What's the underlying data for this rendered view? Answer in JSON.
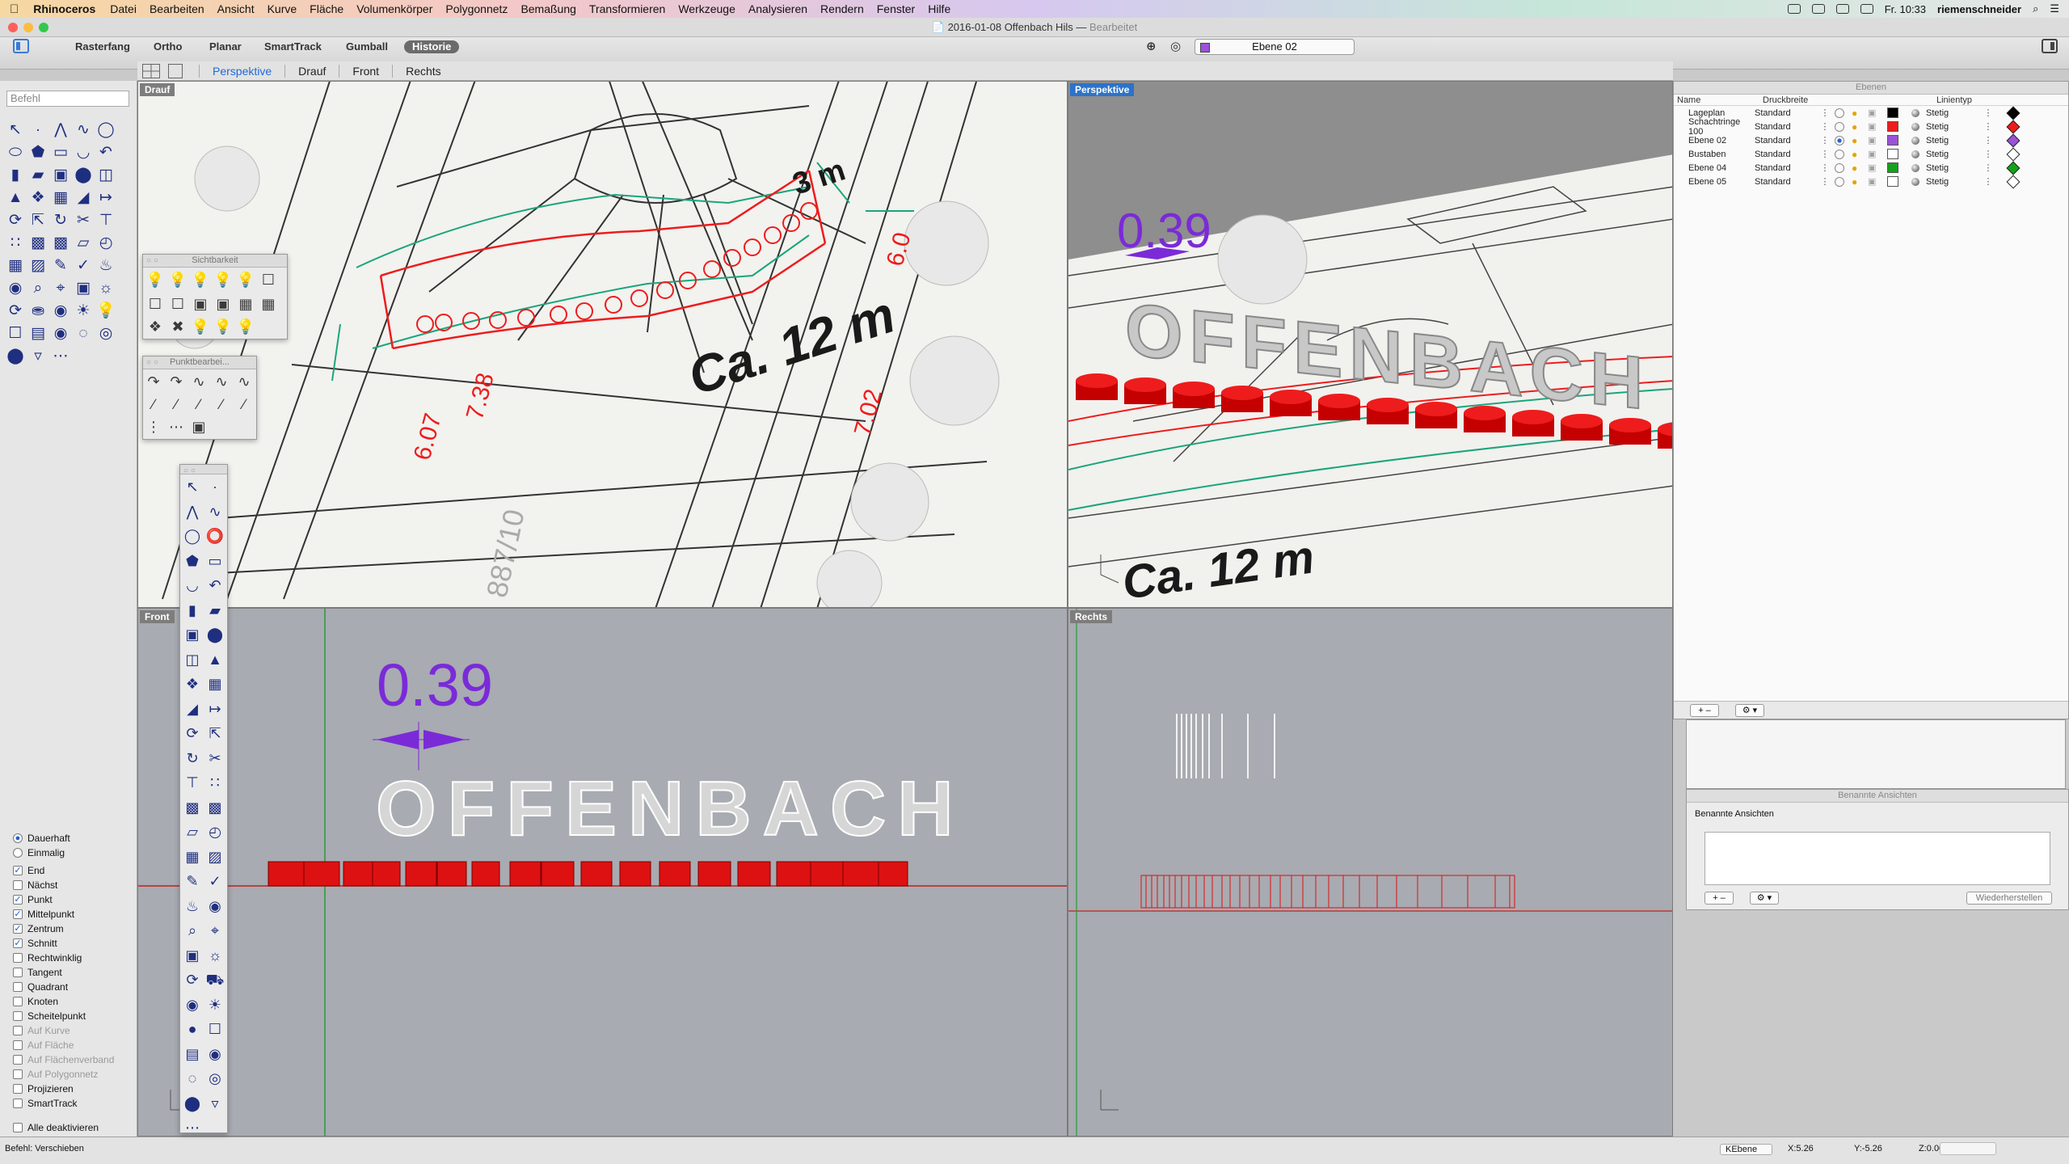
{
  "menubar": {
    "app": "Rhinoceros",
    "menus": [
      "Datei",
      "Bearbeiten",
      "Ansicht",
      "Kurve",
      "Fläche",
      "Volumenkörper",
      "Polygonnetz",
      "Bemaßung",
      "Transformieren",
      "Werkzeuge",
      "Analysieren",
      "Rendern",
      "Fenster",
      "Hilfe"
    ],
    "clock": "Fr. 10:33",
    "user": "riemenschneider"
  },
  "window": {
    "title": "2016-01-08 Offenbach Hils",
    "subtitle": "Bearbeitet"
  },
  "toolbar": {
    "buttons": [
      "Rasterfang",
      "Ortho",
      "Planar",
      "SmartTrack",
      "Gumball",
      "Historie"
    ],
    "layer": "Ebene 02"
  },
  "viewtabs": [
    "Perspektive",
    "Drauf",
    "Front",
    "Rechts"
  ],
  "command": {
    "placeholder": "Befehl",
    "status": "Befehl: Verschieben"
  },
  "viewports": {
    "top": "Drauf",
    "persp": "Perspektive",
    "front": "Front",
    "right": "Rechts"
  },
  "panels": {
    "visibility": "Sichtbarkeit",
    "points": "Punktbearbei..."
  },
  "snaps": {
    "mode": [
      {
        "label": "Dauerhaft",
        "on": true
      },
      {
        "label": "Einmalig",
        "on": false
      }
    ],
    "items": [
      {
        "label": "End",
        "on": true
      },
      {
        "label": "Nächst",
        "on": false
      },
      {
        "label": "Punkt",
        "on": true
      },
      {
        "label": "Mittelpunkt",
        "on": true
      },
      {
        "label": "Zentrum",
        "on": true
      },
      {
        "label": "Schnitt",
        "on": true
      },
      {
        "label": "Rechtwinklig",
        "on": false
      },
      {
        "label": "Tangent",
        "on": false
      },
      {
        "label": "Quadrant",
        "on": false
      },
      {
        "label": "Knoten",
        "on": false
      },
      {
        "label": "Scheitelpunkt",
        "on": false
      },
      {
        "label": "Auf Kurve",
        "on": false,
        "dim": true
      },
      {
        "label": "Auf Fläche",
        "on": false,
        "dim": true
      },
      {
        "label": "Auf Flächenverband",
        "on": false,
        "dim": true
      },
      {
        "label": "Auf Polygonnetz",
        "on": false,
        "dim": true
      },
      {
        "label": "Projizieren",
        "on": false
      },
      {
        "label": "SmartTrack",
        "on": false
      }
    ],
    "disable_all": "Alle deaktivieren"
  },
  "layers": {
    "title": "Ebenen",
    "columns": [
      "Name",
      "Druckbreite",
      "Linientyp"
    ],
    "rows": [
      {
        "name": "Lageplan",
        "print": "Standard",
        "color": "#000000",
        "linetype": "Stetig",
        "current": false,
        "dia": "#000000"
      },
      {
        "name": "Schachtringe 100",
        "print": "Standard",
        "color": "#ee1c1c",
        "linetype": "Stetig",
        "current": false,
        "dia": "#ee1c1c"
      },
      {
        "name": "Ebene 02",
        "print": "Standard",
        "color": "#9a52d6",
        "linetype": "Stetig",
        "current": true,
        "dia": "#9a52d6"
      },
      {
        "name": "Bustaben",
        "print": "Standard",
        "color": "#ffffff",
        "linetype": "Stetig",
        "current": false,
        "dia": "#ffffff"
      },
      {
        "name": "Ebene 04",
        "print": "Standard",
        "color": "#16a11c",
        "linetype": "Stetig",
        "current": false,
        "dia": "#16a11c"
      },
      {
        "name": "Ebene 05",
        "print": "Standard",
        "color": "#ffffff",
        "linetype": "Stetig",
        "current": false,
        "dia": "#ffffff"
      }
    ]
  },
  "named_views": {
    "title": "Benannte Ansichten",
    "label": "Benannte Ansichten",
    "restore": "Wiederherstellen"
  },
  "drawing": {
    "dimension": "0.39",
    "city": "OFFENBACH",
    "note": "Ca. 12 m",
    "meas": [
      "3 m",
      "6.07",
      "7.38",
      "7.02",
      "6.0"
    ],
    "parcel": "887/10"
  },
  "statusbar": {
    "plane": "KEbene",
    "x": "X:5.26",
    "y": "Y:-5.26",
    "z": "Z:0.00"
  },
  "colors": {
    "accent": "#2c73c9",
    "red": "#ee1c1c",
    "purple": "#7b2ad8",
    "teal": "#1aa57c"
  }
}
